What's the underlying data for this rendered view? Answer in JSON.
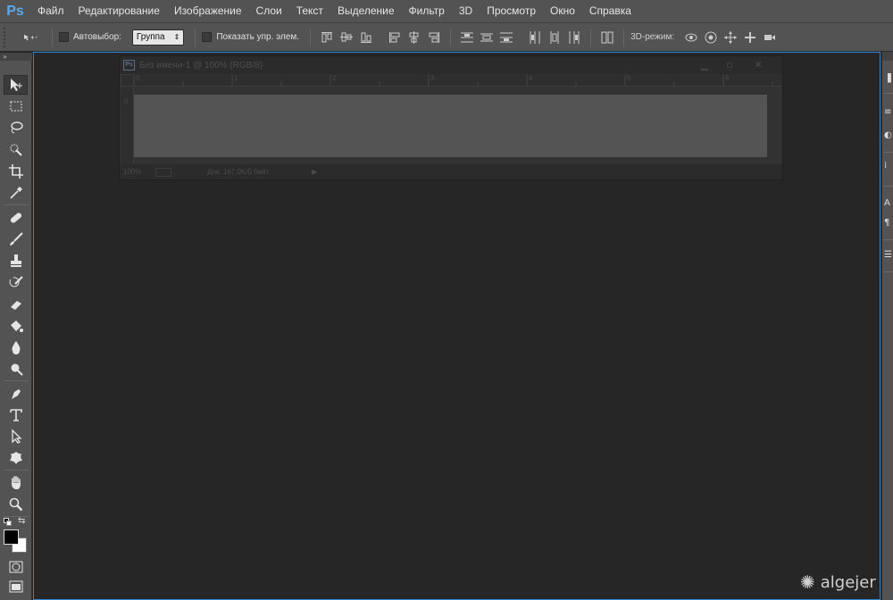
{
  "app": {
    "logo": "Ps",
    "accent": "#2f86d5",
    "logo_color": "#5ba9e8"
  },
  "menu": [
    "Файл",
    "Редактирование",
    "Изображение",
    "Слои",
    "Текст",
    "Выделение",
    "Фильтр",
    "3D",
    "Просмотр",
    "Окно",
    "Справка"
  ],
  "options": {
    "autoselect_label": "Автовыбор:",
    "autoselect_value": "Группа",
    "show_controls_label": "Показать упр. элем.",
    "mode3d_label": "3D-режим:"
  },
  "tools_header": "»",
  "tools": [
    "move",
    "marquee",
    "lasso",
    "quick-select",
    "crop",
    "eyedropper",
    "healing",
    "brush",
    "clone-stamp",
    "history-brush",
    "eraser",
    "paint-bucket",
    "blur",
    "dodge",
    "pen",
    "type",
    "path-select",
    "shape",
    "hand",
    "zoom"
  ],
  "document": {
    "title": "Без имени-1 @ 100% (RGB/8)",
    "ruler_marks": [
      "0",
      "1",
      "2",
      "3",
      "4",
      "5",
      "6"
    ],
    "ruler_left_mark": "0",
    "zoom": "100%",
    "doc_info": "Док: 167,0K/0 байт",
    "canvas_color": "#545454"
  },
  "watermark": "algejer"
}
